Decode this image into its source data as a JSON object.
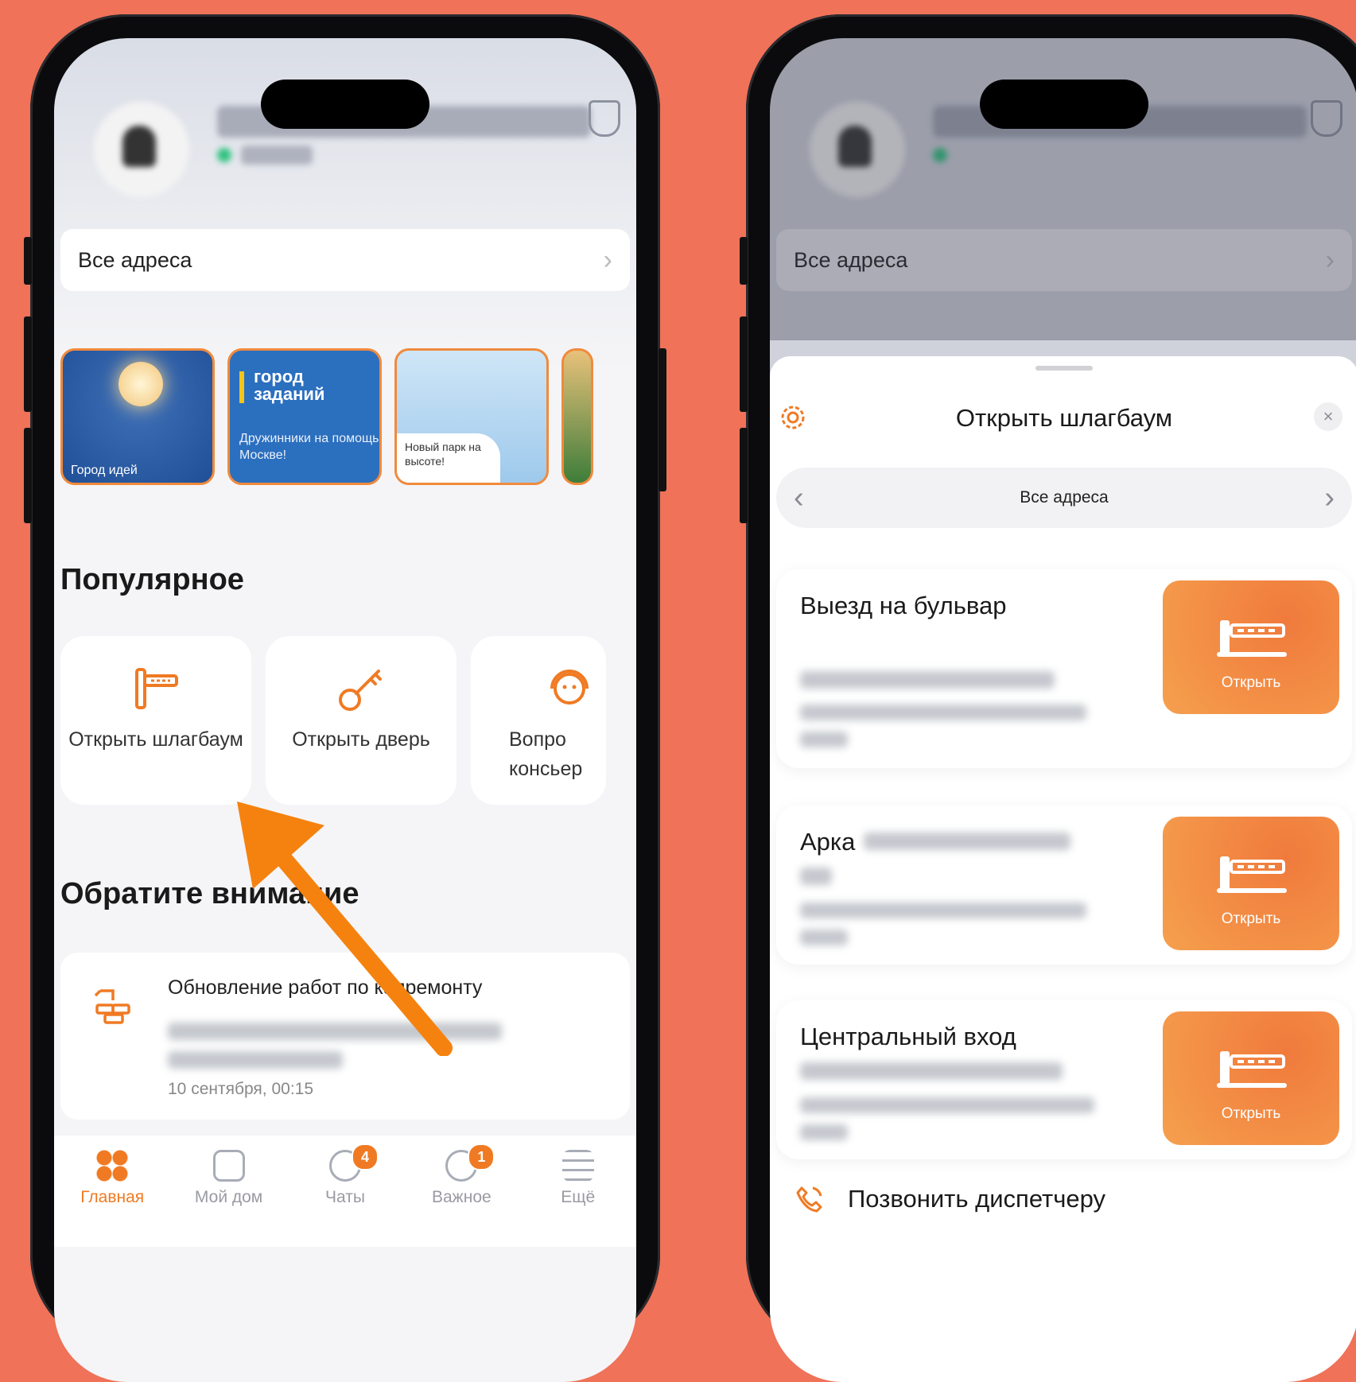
{
  "left_screen": {
    "address_bar": {
      "label": "Все адреса"
    },
    "stories": [
      {
        "label": "Город идей"
      },
      {
        "heading": "город заданий",
        "label": "Дружинники на помощь Москве!"
      },
      {
        "label": "Новый парк на высоте!"
      }
    ],
    "popular": {
      "title": "Популярное",
      "items": [
        {
          "label": "Открыть шлагбаум"
        },
        {
          "label": "Открыть дверь"
        },
        {
          "label": "Вопро консьер"
        }
      ]
    },
    "attention": {
      "title": "Обратите внимание",
      "card": {
        "title": "Обновление работ по капремонту",
        "time": "10 сентября, 00:15"
      }
    },
    "tabbar": [
      {
        "label": "Главная"
      },
      {
        "label": "Мой дом"
      },
      {
        "label": "Чаты",
        "badge": "4"
      },
      {
        "label": "Важное",
        "badge": "1"
      },
      {
        "label": "Ещё"
      }
    ]
  },
  "right_screen": {
    "address_bar": {
      "label": "Все адреса"
    },
    "sheet": {
      "title": "Открыть шлагбаум",
      "address_switch": "Все адреса",
      "gates": [
        {
          "name": "Выезд на бульвар",
          "button": "Открыть"
        },
        {
          "name": "Арка",
          "button": "Открыть"
        },
        {
          "name": "Центральный вход",
          "button": "Открыть"
        }
      ],
      "call_dispatcher": "Позвонить диспетчеру"
    }
  },
  "colors": {
    "background": "#EF7259",
    "accent": "#F07A23"
  }
}
